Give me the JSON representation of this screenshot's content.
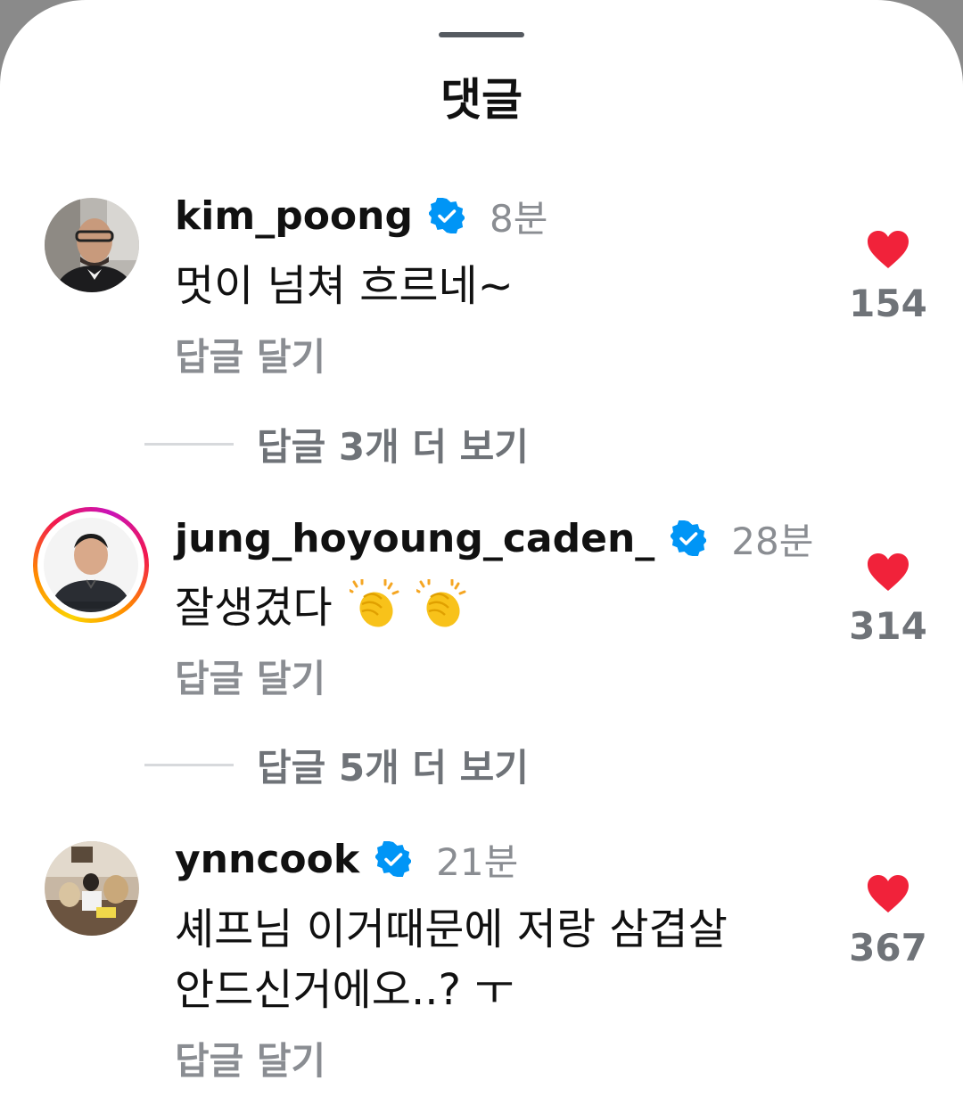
{
  "sheet": {
    "title": "댓글"
  },
  "comments": [
    {
      "username": "kim_poong",
      "time": "8분",
      "text": "멋이 넘쳐 흐르네~",
      "reply_label": "답글 달기",
      "likes": "154",
      "more_replies_label": "답글 3개 더 보기",
      "verified": true,
      "has_story_ring": false
    },
    {
      "username": "jung_hoyoung_caden_",
      "time": "28분",
      "text": "잘생겼다",
      "reply_label": "답글 달기",
      "likes": "314",
      "more_replies_label": "답글 5개 더 보기",
      "verified": true,
      "has_story_ring": true,
      "emoji": [
        "clapping-hands",
        "clapping-hands"
      ]
    },
    {
      "username": "ynncook",
      "time": "21분",
      "text_line1": "셰프님 이거때문에 저랑 삼겹살",
      "text_line2": "안드신거에오..? ㅜ",
      "reply_label": "답글 달기",
      "likes": "367",
      "verified": true,
      "has_story_ring": false
    }
  ],
  "colors": {
    "heart": "#f1223a",
    "verified": "#0095f6",
    "muted_text": "#8a8d92"
  }
}
